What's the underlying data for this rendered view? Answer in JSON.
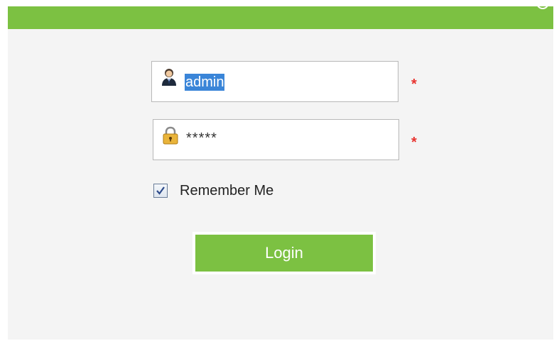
{
  "login_form": {
    "username": {
      "value": "admin",
      "icon": "user-icon",
      "required_mark": "*"
    },
    "password": {
      "value": "*****",
      "icon": "lock-icon",
      "required_mark": "*"
    },
    "remember_me": {
      "label": "Remember Me",
      "checked": true
    },
    "login_label": "Login"
  },
  "colors": {
    "accent": "#7cc142",
    "required": "#e8332f",
    "selection": "#3a85d8",
    "panel_background": "#f4f4f4"
  }
}
